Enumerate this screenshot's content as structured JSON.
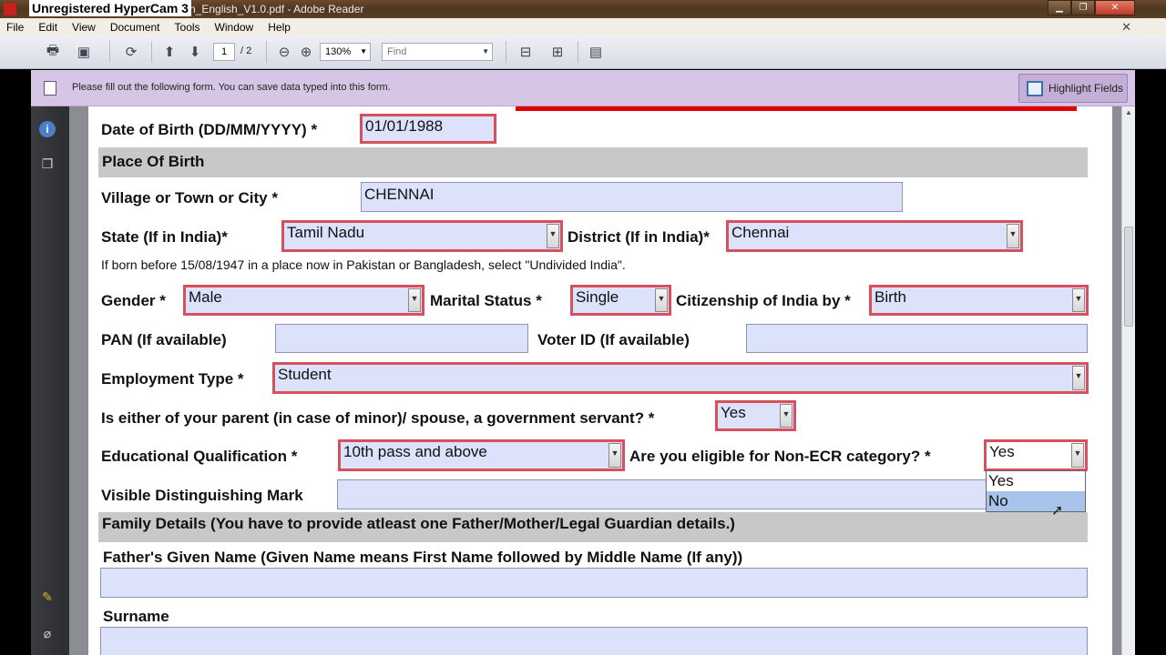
{
  "window": {
    "watermark": "Unregistered HyperCam 3",
    "title": "lain_English_V1.0.pdf - Adobe Reader",
    "minimize": "▁",
    "restore": "❐",
    "close": "✕"
  },
  "menu": {
    "items": [
      "File",
      "Edit",
      "View",
      "Document",
      "Tools",
      "Window",
      "Help"
    ],
    "close_doc": "✕"
  },
  "toolbar": {
    "icons": [
      "print-icon",
      "save-file-icon",
      "collaborate-icon",
      "page-up-icon",
      "page-down-icon",
      "zoom-out-icon",
      "zoom-in-icon",
      "fit-width-icon",
      "fit-page-icon",
      "read-mode-icon"
    ],
    "page_current": "1",
    "page_total": "/ 2",
    "zoom": "130%",
    "find_placeholder": "Find"
  },
  "notice": {
    "message": "Please fill out the following form. You can save data typed into this form.",
    "highlight_label": "Highlight Fields"
  },
  "form": {
    "dob_label": "Date of Birth (DD/MM/YYYY) *",
    "dob_value": "01/01/1988",
    "place_of_birth_header": "Place Of Birth",
    "village_label": "Village or Town or City *",
    "village_value": "CHENNAI",
    "state_label": "State (If in India)*",
    "state_value": "Tamil Nadu",
    "district_label": "District (If in India)*",
    "district_value": "Chennai",
    "pakistan_note": "If born before 15/08/1947 in a place now in Pakistan or Bangladesh, select \"Undivided India\".",
    "gender_label": "Gender *",
    "gender_value": "Male",
    "marital_label": "Marital Status *",
    "marital_value": "Single",
    "citizenship_label": "Citizenship of India by *",
    "citizenship_value": "Birth",
    "pan_label": "PAN (If available)",
    "pan_value": "",
    "voter_label": "Voter ID (If available)",
    "voter_value": "",
    "employment_label": "Employment Type *",
    "employment_value": "Student",
    "govt_servant_label": "Is either of your parent (in case of minor)/ spouse, a government servant? *",
    "govt_servant_value": "Yes",
    "education_label": "Educational Qualification *",
    "education_value": "10th pass and above",
    "non_ecr_label": "Are you eligible for Non-ECR category? *",
    "non_ecr_value": "Yes",
    "non_ecr_options": [
      "Yes",
      "No"
    ],
    "visible_mark_label": "Visible Distinguishing Mark",
    "visible_mark_value": "",
    "family_header": "Family Details  (You have to provide atleast one Father/Mother/Legal Guardian details.)",
    "father_label": "Father's Given Name (Given Name means First Name followed by Middle Name (If any))",
    "father_value": "",
    "surname_label": "Surname",
    "surname_value": ""
  }
}
